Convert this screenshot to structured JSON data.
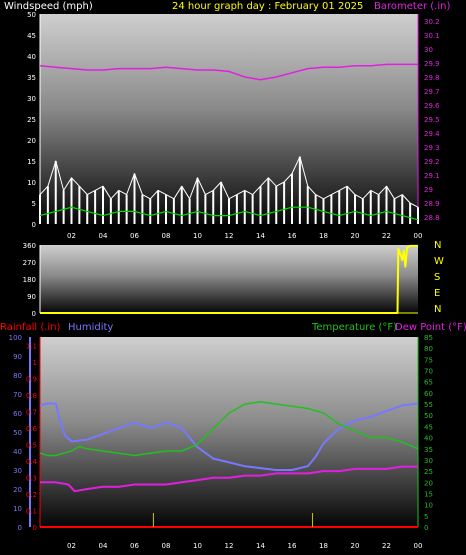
{
  "colors": {
    "wind_gust": "#ffffff",
    "wind_avg": "#00dd00",
    "barometer": "#e020e0",
    "direction": "#ffff00",
    "rainfall": "#ff0000",
    "humidity": "#7878ff",
    "temperature": "#20c020",
    "dewpoint": "#e020e0",
    "title": "#ffff00"
  },
  "header": {
    "windspeed_label": "Windspeed (mph)",
    "title": "24 hour graph day : February 01 2025",
    "barometer_label": "Barometer (.in)"
  },
  "bottom_header": {
    "rainfall_label": "Rainfall (.in)",
    "humidity_label": "Humidity",
    "temperature_label": "Temperature (°F)",
    "dewpoint_label": "Dew Point (°F)"
  },
  "chart_data": [
    {
      "type": "line",
      "name": "wind-and-barometer",
      "x_tick_labels": [
        "02",
        "04",
        "06",
        "08",
        "10",
        "12",
        "14",
        "16",
        "18",
        "20",
        "22",
        "00"
      ],
      "x_range_hours": [
        0,
        24
      ],
      "y_left_label": "Windspeed (mph)",
      "y_left_ticks": [
        0,
        5,
        10,
        15,
        20,
        25,
        30,
        35,
        40,
        45,
        50
      ],
      "y_left_range": [
        0,
        50
      ],
      "y_right_label": "Barometer (.in)",
      "y_right_ticks": [
        "28.8",
        "28.9",
        "29",
        "29.1",
        "29.2",
        "29.3",
        "29.4",
        "29.5",
        "29.6",
        "29.7",
        "29.8",
        "29.9",
        "30",
        "30.1",
        "30.2"
      ],
      "y_right_range": [
        28.75,
        30.25
      ],
      "series": [
        {
          "name": "Barometer",
          "axis": "right",
          "x": [
            0,
            1,
            2,
            3,
            4,
            5,
            6,
            7,
            8,
            9,
            10,
            11,
            12,
            12.5,
            13,
            13.5,
            14,
            14.5,
            15,
            16,
            17,
            18,
            19,
            20,
            21,
            22,
            23,
            24
          ],
          "y": [
            29.88,
            29.87,
            29.86,
            29.85,
            29.85,
            29.86,
            29.86,
            29.86,
            29.87,
            29.86,
            29.85,
            29.85,
            29.84,
            29.82,
            29.8,
            29.79,
            29.78,
            29.79,
            29.8,
            29.83,
            29.86,
            29.87,
            29.87,
            29.88,
            29.88,
            29.89,
            29.89,
            29.89
          ]
        },
        {
          "name": "Wind gust",
          "axis": "left",
          "x": [
            0,
            0.5,
            1,
            1.5,
            2,
            2.5,
            3,
            3.5,
            4,
            4.5,
            5,
            5.5,
            6,
            6.5,
            7,
            7.5,
            8,
            8.5,
            9,
            9.5,
            10,
            10.5,
            11,
            11.5,
            12,
            12.5,
            13,
            13.5,
            14,
            14.5,
            15,
            15.5,
            16,
            16.5,
            17,
            17.5,
            18,
            18.5,
            19,
            19.5,
            20,
            20.5,
            21,
            21.5,
            22,
            22.5,
            23,
            23.5,
            24
          ],
          "y": [
            7,
            9,
            15,
            8,
            11,
            9,
            7,
            8,
            9,
            6,
            8,
            7,
            12,
            7,
            6,
            8,
            7,
            6,
            9,
            6,
            11,
            7,
            8,
            10,
            6,
            7,
            8,
            7,
            9,
            11,
            9,
            10,
            12,
            16,
            9,
            7,
            6,
            7,
            8,
            9,
            7,
            6,
            8,
            7,
            9,
            6,
            7,
            5,
            4
          ]
        },
        {
          "name": "Wind average",
          "axis": "left",
          "x": [
            0,
            1,
            2,
            3,
            4,
            5,
            6,
            7,
            8,
            9,
            10,
            11,
            12,
            13,
            14,
            15,
            16,
            17,
            18,
            19,
            20,
            21,
            22,
            23,
            24
          ],
          "y": [
            2,
            3,
            4,
            3,
            2,
            3,
            3,
            2,
            3,
            2,
            3,
            2,
            2,
            3,
            2,
            3,
            4,
            4,
            3,
            2,
            3,
            2,
            3,
            2,
            1
          ]
        }
      ]
    },
    {
      "type": "line",
      "name": "wind-direction",
      "x_tick_labels": [
        "02",
        "04",
        "06",
        "08",
        "10",
        "12",
        "14",
        "16",
        "18",
        "20",
        "22",
        "00"
      ],
      "x_range_hours": [
        0,
        24
      ],
      "y_ticks": [
        0,
        90,
        180,
        270,
        360
      ],
      "y_range": [
        0,
        360
      ],
      "compass_labels": [
        "N",
        "W",
        "S",
        "E",
        "N"
      ],
      "series": [
        {
          "name": "Wind direction",
          "x": [
            0,
            22.7,
            22.75,
            22.85,
            23.0,
            23.1,
            23.2,
            23.3,
            23.5,
            24
          ],
          "y": [
            0,
            0,
            340,
            320,
            280,
            330,
            245,
            345,
            355,
            355
          ]
        }
      ]
    },
    {
      "type": "line",
      "name": "rain-humidity-temperature",
      "x_tick_labels": [
        "02",
        "04",
        "06",
        "08",
        "10",
        "12",
        "14",
        "16",
        "18",
        "20",
        "22",
        "00"
      ],
      "x_range_hours": [
        0,
        24
      ],
      "y_rain_label": "Rainfall (.in)",
      "y_rain_ticks": [
        "0",
        "0.1",
        "0.2",
        "0.3",
        "0.4",
        "0.5",
        "0.6",
        "0.7",
        "0.8",
        "0.9",
        "1",
        "1.1"
      ],
      "y_rain_range": [
        0,
        1.15
      ],
      "y_humidity_label": "Humidity",
      "y_humidity_ticks": [
        0,
        10,
        20,
        30,
        40,
        50,
        60,
        70,
        80,
        90,
        100
      ],
      "y_humidity_range": [
        0,
        100
      ],
      "y_temp_label": "Temperature (°F)",
      "y_temp_ticks": [
        0,
        5,
        10,
        15,
        20,
        25,
        30,
        35,
        40,
        45,
        50,
        55,
        60,
        65,
        70,
        75,
        80,
        85
      ],
      "y_temp_range": [
        0,
        85
      ],
      "series": [
        {
          "name": "Humidity",
          "axis": "humidity",
          "x": [
            0,
            0.5,
            1,
            1.3,
            1.6,
            2,
            3,
            4,
            5,
            6,
            7,
            8,
            9,
            10,
            11,
            12,
            13,
            14,
            15,
            16,
            17,
            17.5,
            18,
            19,
            20,
            21,
            22,
            23,
            24
          ],
          "y": [
            64,
            65,
            65,
            55,
            48,
            45,
            46,
            49,
            52,
            55,
            52,
            55,
            52,
            42,
            36,
            34,
            32,
            31,
            30,
            30,
            32,
            37,
            44,
            52,
            56,
            58,
            61,
            64,
            65
          ]
        },
        {
          "name": "Temperature",
          "axis": "temp",
          "x": [
            0,
            0.5,
            1,
            1.5,
            2,
            2.5,
            3,
            4,
            5,
            6,
            7,
            8,
            9,
            10,
            11,
            12,
            13,
            14,
            15,
            16,
            17,
            18,
            19,
            20,
            21,
            22,
            23,
            24
          ],
          "y": [
            33,
            32,
            32,
            33,
            34,
            36,
            35,
            34,
            33,
            32,
            33,
            34,
            34,
            37,
            44,
            51,
            55,
            56,
            55,
            54,
            53,
            51,
            46,
            43,
            40,
            40,
            38,
            35
          ]
        },
        {
          "name": "Dew Point",
          "axis": "temp",
          "x": [
            0,
            1,
            1.8,
            2.2,
            3,
            4,
            5,
            6,
            7,
            8,
            9,
            10,
            11,
            12,
            13,
            14,
            15,
            16,
            17,
            18,
            19,
            20,
            21,
            22,
            23,
            24
          ],
          "y": [
            20,
            20,
            19,
            16,
            17,
            18,
            18,
            19,
            19,
            19,
            20,
            21,
            22,
            22,
            23,
            23,
            24,
            24,
            24,
            25,
            25,
            26,
            26,
            26,
            27,
            27
          ]
        },
        {
          "name": "Rainfall",
          "axis": "rain",
          "x": [
            0,
            24
          ],
          "y": [
            0,
            0
          ]
        }
      ],
      "marker_hours": [
        7.2,
        17.3
      ]
    }
  ]
}
